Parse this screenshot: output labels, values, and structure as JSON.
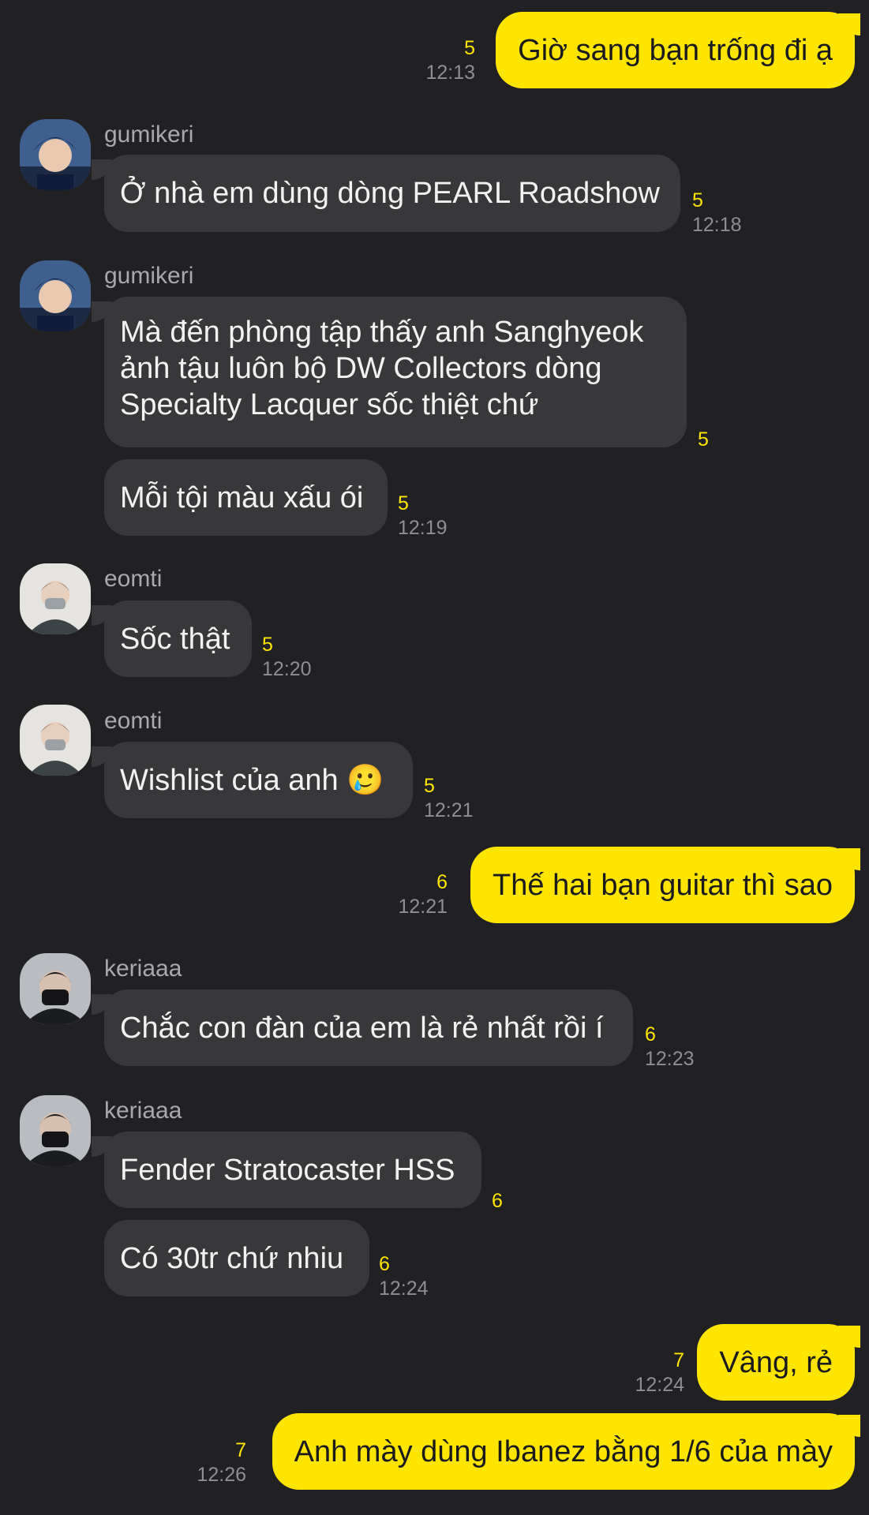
{
  "messages": [
    {
      "dir": "out",
      "text": "Giờ sang bạn trống đi ạ",
      "unread": "5",
      "time": "12:13"
    },
    {
      "dir": "in",
      "sender": "gumikeri",
      "text": "Ở nhà em dùng dòng PEARL Roadshow",
      "unread": "5",
      "time": "12:18"
    },
    {
      "dir": "in",
      "sender": "gumikeri",
      "text": "Mà đến phòng tập thấy anh Sanghyeok ảnh tậu luôn bộ DW Collectors dòng Specialty Lacquer sốc thiệt chứ",
      "unread": "5"
    },
    {
      "dir": "in",
      "text": "Mỗi tội màu xấu ói",
      "unread": "5",
      "time": "12:19"
    },
    {
      "dir": "in",
      "sender": "eomti",
      "text": "Sốc thật",
      "unread": "5",
      "time": "12:20"
    },
    {
      "dir": "in",
      "sender": "eomti",
      "text": "Wishlist của anh 🥲",
      "unread": "5",
      "time": "12:21"
    },
    {
      "dir": "out",
      "text": "Thế hai bạn guitar thì sao",
      "unread": "6",
      "time": "12:21"
    },
    {
      "dir": "in",
      "sender": "keriaaa",
      "text": "Chắc con đàn của em là rẻ nhất rồi í",
      "unread": "6",
      "time": "12:23"
    },
    {
      "dir": "in",
      "sender": "keriaaa",
      "text": "Fender Stratocaster HSS",
      "unread": "6"
    },
    {
      "dir": "in",
      "text": "Có 30tr chứ nhiu",
      "unread": "6",
      "time": "12:24"
    },
    {
      "dir": "out",
      "text": "Vâng, rẻ",
      "unread": "7",
      "time": "12:24"
    },
    {
      "dir": "out",
      "text": "Anh mày dùng Ibanez bằng 1/6 của mày",
      "unread": "7",
      "time": "12:26"
    }
  ],
  "colors": {
    "background": "#212123",
    "outgoing_bubble": "#FEE500",
    "incoming_bubble": "#38383B",
    "unread_count": "#FEE500"
  }
}
